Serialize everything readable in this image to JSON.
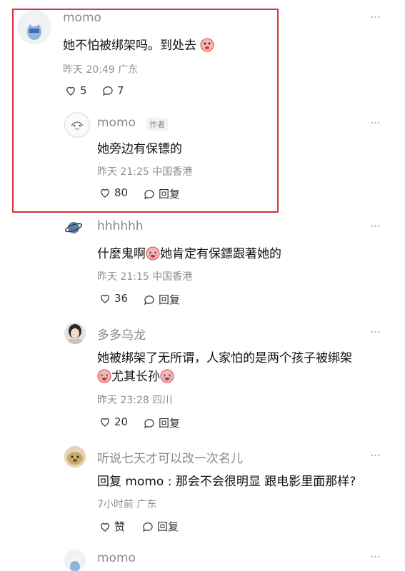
{
  "comments": [
    {
      "user": "momo",
      "text": "她不怕被绑架吗。到处去",
      "time": "昨天 20:49",
      "location": "广东",
      "likes": "5",
      "replies": "7",
      "reply": {
        "user": "momo",
        "author_tag": "作者",
        "text": "她旁边有保镖的",
        "time": "昨天 21:25",
        "location": "中国香港",
        "likes": "80",
        "reply_label": "回复"
      }
    },
    {
      "user": "hhhhhh",
      "text": "什麼鬼啊",
      "text2": "她肯定有保鏢跟著她的",
      "time": "昨天 21:15",
      "location": "中国香港",
      "likes": "36",
      "reply_label": "回复"
    },
    {
      "user": "多多乌龙",
      "text": "她被绑架了无所谓，人家怕的是两个孩子被绑架",
      "text_line2": "尤其长孙",
      "time": "昨天 23:28",
      "location": "四川",
      "likes": "20",
      "reply_label": "回复"
    },
    {
      "user": "听说七天才可以改一次名儿",
      "text": "回复 momo : 那会不会很明显 跟电影里面那样?",
      "time": "7小时前",
      "location": "广东",
      "likes": "赞",
      "reply_label": "回复"
    },
    {
      "user": "momo"
    }
  ],
  "colors": {
    "highlight_border": "#d8323a",
    "name": "#8a8a8a",
    "meta": "#8f8f8f"
  },
  "icons": [
    "heart-icon",
    "comment-bubble-icon",
    "more-dots-icon",
    "crying-face-emoji"
  ]
}
